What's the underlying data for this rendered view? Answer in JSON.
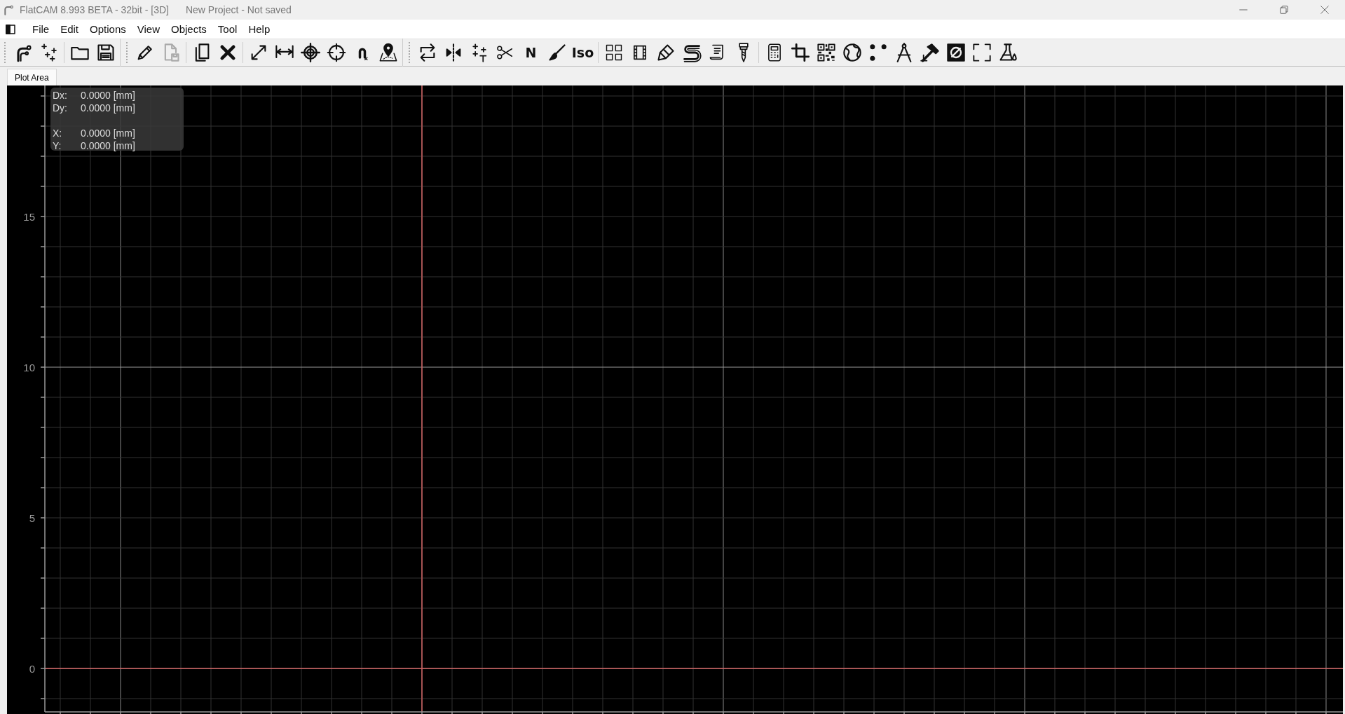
{
  "window": {
    "title": "FlatCAM 8.993 BETA - 32bit - [3D]",
    "project": "New Project - Not saved"
  },
  "menu": [
    "File",
    "Edit",
    "Options",
    "View",
    "Objects",
    "Tool",
    "Help"
  ],
  "toolbar": [
    {
      "sections": [
        [
          {
            "kind": "route",
            "disabled": false
          },
          {
            "kind": "points",
            "disabled": false
          }
        ],
        [
          {
            "kind": "folder",
            "disabled": false
          },
          {
            "kind": "save",
            "disabled": false
          }
        ]
      ]
    },
    {
      "sections": [
        [
          {
            "kind": "pencil",
            "disabled": false
          },
          {
            "kind": "saveas",
            "disabled": true
          }
        ],
        [
          {
            "kind": "copy",
            "disabled": false
          },
          {
            "kind": "delete",
            "disabled": false
          }
        ],
        [
          {
            "kind": "resize",
            "disabled": false
          },
          {
            "kind": "measure",
            "disabled": false
          },
          {
            "kind": "target",
            "disabled": false
          },
          {
            "kind": "crosshair",
            "disabled": false
          },
          {
            "kind": "magnet",
            "disabled": false
          },
          {
            "kind": "pin",
            "disabled": false
          }
        ]
      ]
    },
    {
      "sections": [
        [
          {
            "kind": "swap",
            "disabled": false
          },
          {
            "kind": "mirror",
            "disabled": false
          },
          {
            "kind": "pointst",
            "disabled": false
          },
          {
            "kind": "scissors",
            "disabled": false
          },
          {
            "kind": "letter",
            "label": "N",
            "disabled": false
          },
          {
            "kind": "brush",
            "disabled": false
          },
          {
            "kind": "letter",
            "label": "Iso",
            "disabled": false
          }
        ],
        [
          {
            "kind": "grid",
            "disabled": false
          },
          {
            "kind": "film",
            "disabled": false
          },
          {
            "kind": "paint",
            "disabled": false
          },
          {
            "kind": "curves",
            "disabled": false
          },
          {
            "kind": "scroll",
            "disabled": false
          },
          {
            "kind": "drill",
            "disabled": false
          }
        ],
        [
          {
            "kind": "calculator",
            "disabled": false
          },
          {
            "kind": "crop",
            "disabled": false
          },
          {
            "kind": "qr",
            "disabled": false
          },
          {
            "kind": "globe",
            "disabled": false
          },
          {
            "kind": "dots",
            "disabled": false
          },
          {
            "kind": "compass",
            "disabled": false
          },
          {
            "kind": "hammer",
            "disabled": false
          },
          {
            "kind": "slash",
            "disabled": false
          },
          {
            "kind": "fullscreen",
            "disabled": false
          },
          {
            "kind": "flask",
            "disabled": false
          }
        ]
      ]
    }
  ],
  "tabs": [
    {
      "label": "Plot Area",
      "selected": true
    }
  ],
  "readouts": [
    [
      {
        "label": "Dx:",
        "value": "0.0000 [mm]"
      },
      {
        "label": "Dy:",
        "value": "0.0000 [mm]"
      }
    ],
    [
      {
        "label": "X:",
        "value": "0.0000 [mm]"
      },
      {
        "label": "Y:",
        "value": "0.0000 [mm]"
      }
    ]
  ],
  "plot": {
    "y_tick_labels": [
      "15",
      "10",
      "5",
      "0"
    ]
  }
}
